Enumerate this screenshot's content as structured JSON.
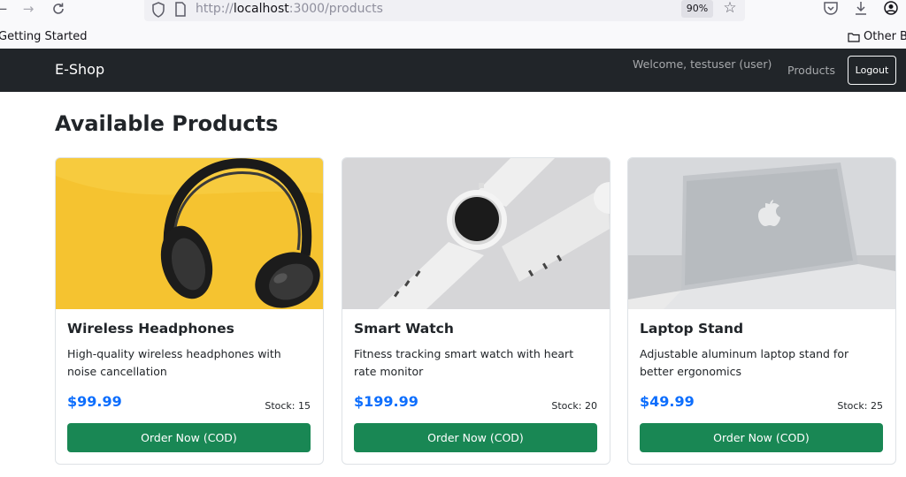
{
  "browser": {
    "back_icon": "arrow-left-icon",
    "forward_icon": "arrow-right-icon",
    "reload_icon": "reload-icon",
    "url_prefix": "http://",
    "url_host": "localhost",
    "url_rest": ":3000/products",
    "zoom": "90%",
    "bookmark_left": "Getting Started",
    "bookmark_right": "Other B"
  },
  "navbar": {
    "brand": "E-Shop",
    "welcome": "Welcome, testuser (user)",
    "products_link": "Products",
    "logout": "Logout"
  },
  "page": {
    "heading": "Available Products"
  },
  "products": [
    {
      "name": "Wireless Headphones",
      "description": "High-quality wireless headphones with noise cancellation",
      "price": "$99.99",
      "stock": "Stock: 15",
      "button": "Order Now (COD)"
    },
    {
      "name": "Smart Watch",
      "description": "Fitness tracking smart watch with heart rate monitor",
      "price": "$199.99",
      "stock": "Stock: 20",
      "button": "Order Now (COD)"
    },
    {
      "name": "Laptop Stand",
      "description": "Adjustable aluminum laptop stand for better ergonomics",
      "price": "$49.99",
      "stock": "Stock: 25",
      "button": "Order Now (COD)"
    }
  ],
  "colors": {
    "navbar_bg": "#212529",
    "price": "#0d6efd",
    "order_button": "#198754"
  }
}
